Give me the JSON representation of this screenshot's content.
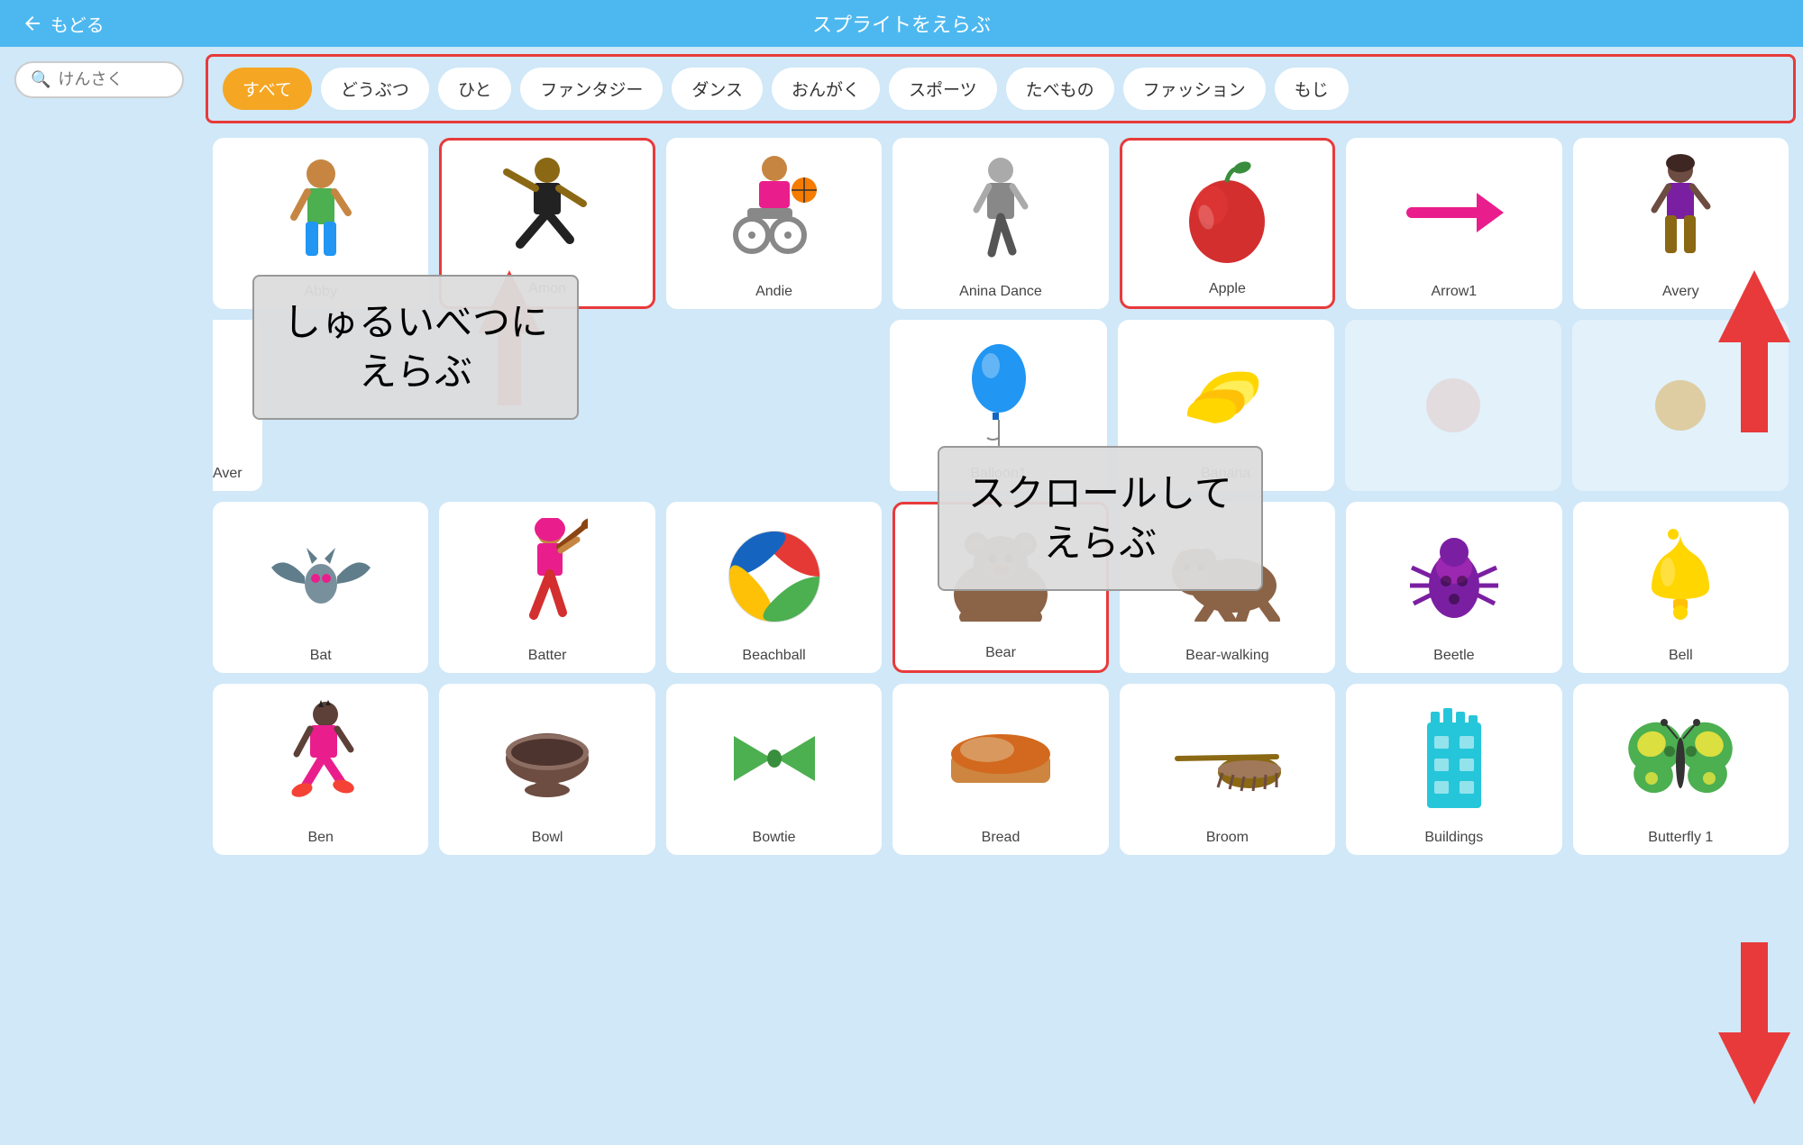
{
  "header": {
    "back_label": "もどる",
    "title": "スプライトをえらぶ"
  },
  "search": {
    "placeholder": "けんさく"
  },
  "categories": [
    {
      "id": "all",
      "label": "すべて",
      "active": true
    },
    {
      "id": "animals",
      "label": "どうぶつ",
      "active": false
    },
    {
      "id": "people",
      "label": "ひと",
      "active": false
    },
    {
      "id": "fantasy",
      "label": "ファンタジー",
      "active": false
    },
    {
      "id": "dance",
      "label": "ダンス",
      "active": false
    },
    {
      "id": "music",
      "label": "おんがく",
      "active": false
    },
    {
      "id": "sports",
      "label": "スポーツ",
      "active": false
    },
    {
      "id": "food",
      "label": "たべもの",
      "active": false
    },
    {
      "id": "fashion",
      "label": "ファッション",
      "active": false
    },
    {
      "id": "letters",
      "label": "もじ",
      "active": false
    }
  ],
  "sprites_row1": [
    {
      "name": "Abby",
      "emoji": "🧍‍♀️"
    },
    {
      "name": "Amon",
      "emoji": "🕺"
    },
    {
      "name": "Andie",
      "emoji": "🧑‍🦽"
    },
    {
      "name": "Anina Dance",
      "emoji": "🚶"
    },
    {
      "name": "Apple",
      "emoji": "🍎"
    },
    {
      "name": "Arrow1",
      "emoji": "➡️"
    },
    {
      "name": "Avery",
      "emoji": "🧍‍♀️"
    }
  ],
  "sprites_row2": [
    {
      "name": "Aver",
      "emoji": "🧍",
      "partial": true
    },
    {
      "name": "Balloon1",
      "emoji": "🎈"
    },
    {
      "name": "Banana",
      "emoji": "🍌"
    },
    {
      "name": "",
      "emoji": ""
    },
    {
      "name": "",
      "emoji": ""
    }
  ],
  "sprites_row3": [
    {
      "name": "Bat",
      "emoji": "🦇"
    },
    {
      "name": "Batter",
      "emoji": "⚾"
    },
    {
      "name": "Beachball",
      "emoji": "🏐"
    },
    {
      "name": "Bear",
      "emoji": "🐻"
    },
    {
      "name": "Bear-walking",
      "emoji": "🐻"
    },
    {
      "name": "Beetle",
      "emoji": "🪲"
    },
    {
      "name": "Bell",
      "emoji": "🔔"
    }
  ],
  "sprites_row4": [
    {
      "name": "Ben",
      "emoji": "🏃"
    },
    {
      "name": "Bowl",
      "emoji": "🥣"
    },
    {
      "name": "Bowtie",
      "emoji": "🎀"
    },
    {
      "name": "Bread",
      "emoji": "🍞"
    },
    {
      "name": "Broom",
      "emoji": "🧹"
    },
    {
      "name": "Buildings",
      "emoji": "🏢"
    },
    {
      "name": "Butterfly 1",
      "emoji": "🦋"
    }
  ],
  "tooltips": {
    "category": "しゅるいべつに\nえらぶ",
    "scroll": "スクロールして\nえらぶ"
  }
}
